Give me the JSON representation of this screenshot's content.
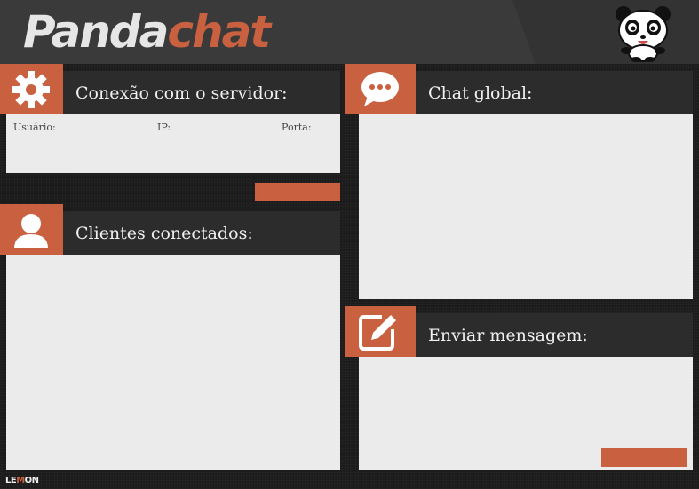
{
  "app": {
    "logo_part1": "Panda",
    "logo_part2": "chat"
  },
  "colors": {
    "accent": "#c9603f",
    "header": "#3a3a3a",
    "bar": "#2c2c2c",
    "pane": "#ebebeb",
    "background": "#1b1b1b"
  },
  "server": {
    "title": "Conexão com o servidor:",
    "icon": "gear-icon",
    "fields": {
      "user_label": "Usuário:",
      "ip_label": "IP:",
      "port_label": "Porta:"
    }
  },
  "clients": {
    "title": "Clientes conectados:",
    "icon": "user-icon"
  },
  "chat": {
    "title": "Chat global:",
    "icon": "speech-bubble-icon"
  },
  "send": {
    "title": "Enviar mensagem:",
    "icon": "edit-icon"
  },
  "footer": {
    "brand_start": "LE",
    "brand_mid": "M",
    "brand_end": "ON"
  }
}
